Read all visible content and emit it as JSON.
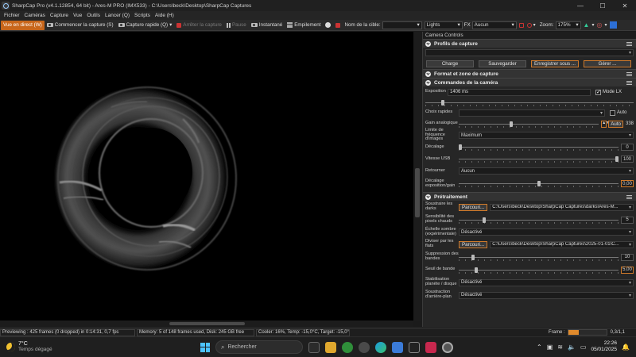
{
  "window": {
    "title": "SharpCap Pro (v4.1.12854, 64 bit) - Ares-M PRO (IMX533) - C:\\Users\\beck\\Desktop\\SharpCap Captures",
    "min": "—",
    "max": "☐",
    "close": "✕"
  },
  "menu": [
    "Fichier",
    "Caméras",
    "Capture",
    "Vue",
    "Outils",
    "Lancer (Q)",
    "Scripts",
    "Aide (H)"
  ],
  "toolbar": {
    "live": "Vue en direct (W)",
    "start_capture": "Commencer la capture (S)",
    "quick_capture": "Capture rapide (Q)",
    "stop_capture": "Arrêter la capture",
    "pause": "Pause",
    "snapshot": "Instantané",
    "stack": "Empilement",
    "target_label": "Nom de la cible:",
    "target_value": "",
    "lights_value": "Lights",
    "fx_label": "FX",
    "fx_value": "Aucun",
    "zoom_label": "Zoom:",
    "zoom_value": "175%"
  },
  "panel": {
    "title": "Camera Controls",
    "profiles": {
      "header": "Profils de capture",
      "selected": "",
      "buttons": [
        "Charge",
        "Sauvegarder",
        "Enregistrer sous ...",
        "Gérer ..."
      ]
    },
    "format_header": "Format et zone de capture",
    "camera": {
      "header": "Commandes de la caméra",
      "exposure_label": "Exposition",
      "exposure_value": "1406 ms",
      "mode_lx": "Mode LX",
      "quick_choice_label": "Choix rapides",
      "quick_choice_value": "",
      "auto_label": "Auto",
      "gain_label": "Gain analogique",
      "gain_auto": "Auto",
      "gain_value": "338",
      "gain_fraction": 0.37,
      "framerate_label": "Limite de fréquence d'images",
      "framerate_value": "Maximum",
      "offset_label": "Décalage",
      "offset_value": "0",
      "offset_fraction": 0.0,
      "usb_label": "Vitesse USB",
      "usb_value": "100",
      "usb_fraction": 1.0,
      "flip_label": "Retourner",
      "flip_value": "Aucun",
      "expgain_label": "Décalage exposition/gain",
      "expgain_value": "0,00",
      "expgain_fraction": 0.5
    },
    "pre": {
      "header": "Prétraitement",
      "darks_label": "Soustraire les darks",
      "darks_browse": "Parcouri...",
      "darks_path": "C:\\Users\\beck\\Desktop\\SharpCap Captures\\darks\\Ares-M...",
      "hot_label": "Sensibilité des pixels chauds",
      "hot_value": "5",
      "hot_fraction": 0.15,
      "dark_scale_label": "Échelle sombre (expérimentale)",
      "dark_scale_value": "Désactivé",
      "flats_label": "Diviser par les flats",
      "flats_browse": "Parcouri...",
      "flats_path": "C:\\Users\\beck\\Desktop\\SharpCap Captures\\2025-01-01\\C...",
      "bands_label": "Suppression des bandes",
      "bands_value": "10",
      "bands_fraction": 0.08,
      "band_threshold_label": "Seuil de bande",
      "band_threshold_value": "5,00",
      "band_threshold_fraction": 0.1,
      "stab_label": "Stabilisation planète / disque",
      "stab_value": "Désactivé",
      "bg_label": "Soustraction d'arrière-plan",
      "bg_value": "Désactivé"
    }
  },
  "status": {
    "preview": "Previewing : 425 frames (0 dropped) in 0:14:31, 0,7 fps",
    "memory": "Memory: 5 of 148 frames used, Disk: 245 GB free",
    "cooler": "Cooler: 16%, Temp: -15,0°C, Target: -15,0°",
    "frame_label": "Frame :",
    "frame_value": "0,3/1,1",
    "frame_fraction": 0.27
  },
  "taskbar": {
    "temp": "7°C",
    "weather": "Temps dégagé",
    "search": "Rechercher",
    "time": "22:26",
    "date": "05/01/2025"
  }
}
